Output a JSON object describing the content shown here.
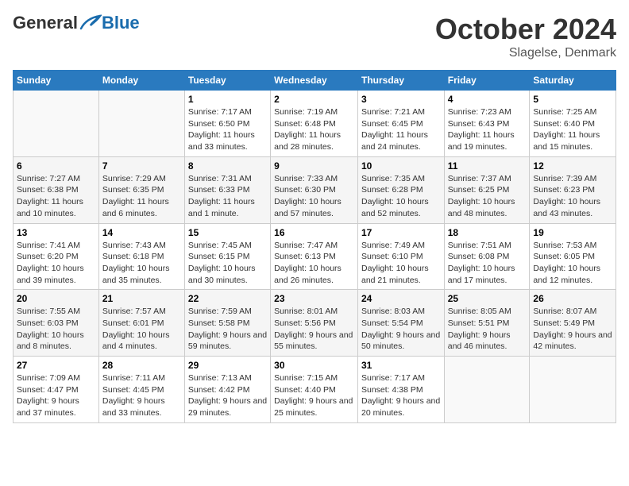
{
  "header": {
    "logo_general": "General",
    "logo_blue": "Blue",
    "month": "October 2024",
    "location": "Slagelse, Denmark"
  },
  "weekdays": [
    "Sunday",
    "Monday",
    "Tuesday",
    "Wednesday",
    "Thursday",
    "Friday",
    "Saturday"
  ],
  "weeks": [
    [
      {
        "day": "",
        "info": ""
      },
      {
        "day": "",
        "info": ""
      },
      {
        "day": "1",
        "info": "Sunrise: 7:17 AM\nSunset: 6:50 PM\nDaylight: 11 hours and 33 minutes."
      },
      {
        "day": "2",
        "info": "Sunrise: 7:19 AM\nSunset: 6:48 PM\nDaylight: 11 hours and 28 minutes."
      },
      {
        "day": "3",
        "info": "Sunrise: 7:21 AM\nSunset: 6:45 PM\nDaylight: 11 hours and 24 minutes."
      },
      {
        "day": "4",
        "info": "Sunrise: 7:23 AM\nSunset: 6:43 PM\nDaylight: 11 hours and 19 minutes."
      },
      {
        "day": "5",
        "info": "Sunrise: 7:25 AM\nSunset: 6:40 PM\nDaylight: 11 hours and 15 minutes."
      }
    ],
    [
      {
        "day": "6",
        "info": "Sunrise: 7:27 AM\nSunset: 6:38 PM\nDaylight: 11 hours and 10 minutes."
      },
      {
        "day": "7",
        "info": "Sunrise: 7:29 AM\nSunset: 6:35 PM\nDaylight: 11 hours and 6 minutes."
      },
      {
        "day": "8",
        "info": "Sunrise: 7:31 AM\nSunset: 6:33 PM\nDaylight: 11 hours and 1 minute."
      },
      {
        "day": "9",
        "info": "Sunrise: 7:33 AM\nSunset: 6:30 PM\nDaylight: 10 hours and 57 minutes."
      },
      {
        "day": "10",
        "info": "Sunrise: 7:35 AM\nSunset: 6:28 PM\nDaylight: 10 hours and 52 minutes."
      },
      {
        "day": "11",
        "info": "Sunrise: 7:37 AM\nSunset: 6:25 PM\nDaylight: 10 hours and 48 minutes."
      },
      {
        "day": "12",
        "info": "Sunrise: 7:39 AM\nSunset: 6:23 PM\nDaylight: 10 hours and 43 minutes."
      }
    ],
    [
      {
        "day": "13",
        "info": "Sunrise: 7:41 AM\nSunset: 6:20 PM\nDaylight: 10 hours and 39 minutes."
      },
      {
        "day": "14",
        "info": "Sunrise: 7:43 AM\nSunset: 6:18 PM\nDaylight: 10 hours and 35 minutes."
      },
      {
        "day": "15",
        "info": "Sunrise: 7:45 AM\nSunset: 6:15 PM\nDaylight: 10 hours and 30 minutes."
      },
      {
        "day": "16",
        "info": "Sunrise: 7:47 AM\nSunset: 6:13 PM\nDaylight: 10 hours and 26 minutes."
      },
      {
        "day": "17",
        "info": "Sunrise: 7:49 AM\nSunset: 6:10 PM\nDaylight: 10 hours and 21 minutes."
      },
      {
        "day": "18",
        "info": "Sunrise: 7:51 AM\nSunset: 6:08 PM\nDaylight: 10 hours and 17 minutes."
      },
      {
        "day": "19",
        "info": "Sunrise: 7:53 AM\nSunset: 6:05 PM\nDaylight: 10 hours and 12 minutes."
      }
    ],
    [
      {
        "day": "20",
        "info": "Sunrise: 7:55 AM\nSunset: 6:03 PM\nDaylight: 10 hours and 8 minutes."
      },
      {
        "day": "21",
        "info": "Sunrise: 7:57 AM\nSunset: 6:01 PM\nDaylight: 10 hours and 4 minutes."
      },
      {
        "day": "22",
        "info": "Sunrise: 7:59 AM\nSunset: 5:58 PM\nDaylight: 9 hours and 59 minutes."
      },
      {
        "day": "23",
        "info": "Sunrise: 8:01 AM\nSunset: 5:56 PM\nDaylight: 9 hours and 55 minutes."
      },
      {
        "day": "24",
        "info": "Sunrise: 8:03 AM\nSunset: 5:54 PM\nDaylight: 9 hours and 50 minutes."
      },
      {
        "day": "25",
        "info": "Sunrise: 8:05 AM\nSunset: 5:51 PM\nDaylight: 9 hours and 46 minutes."
      },
      {
        "day": "26",
        "info": "Sunrise: 8:07 AM\nSunset: 5:49 PM\nDaylight: 9 hours and 42 minutes."
      }
    ],
    [
      {
        "day": "27",
        "info": "Sunrise: 7:09 AM\nSunset: 4:47 PM\nDaylight: 9 hours and 37 minutes."
      },
      {
        "day": "28",
        "info": "Sunrise: 7:11 AM\nSunset: 4:45 PM\nDaylight: 9 hours and 33 minutes."
      },
      {
        "day": "29",
        "info": "Sunrise: 7:13 AM\nSunset: 4:42 PM\nDaylight: 9 hours and 29 minutes."
      },
      {
        "day": "30",
        "info": "Sunrise: 7:15 AM\nSunset: 4:40 PM\nDaylight: 9 hours and 25 minutes."
      },
      {
        "day": "31",
        "info": "Sunrise: 7:17 AM\nSunset: 4:38 PM\nDaylight: 9 hours and 20 minutes."
      },
      {
        "day": "",
        "info": ""
      },
      {
        "day": "",
        "info": ""
      }
    ]
  ]
}
